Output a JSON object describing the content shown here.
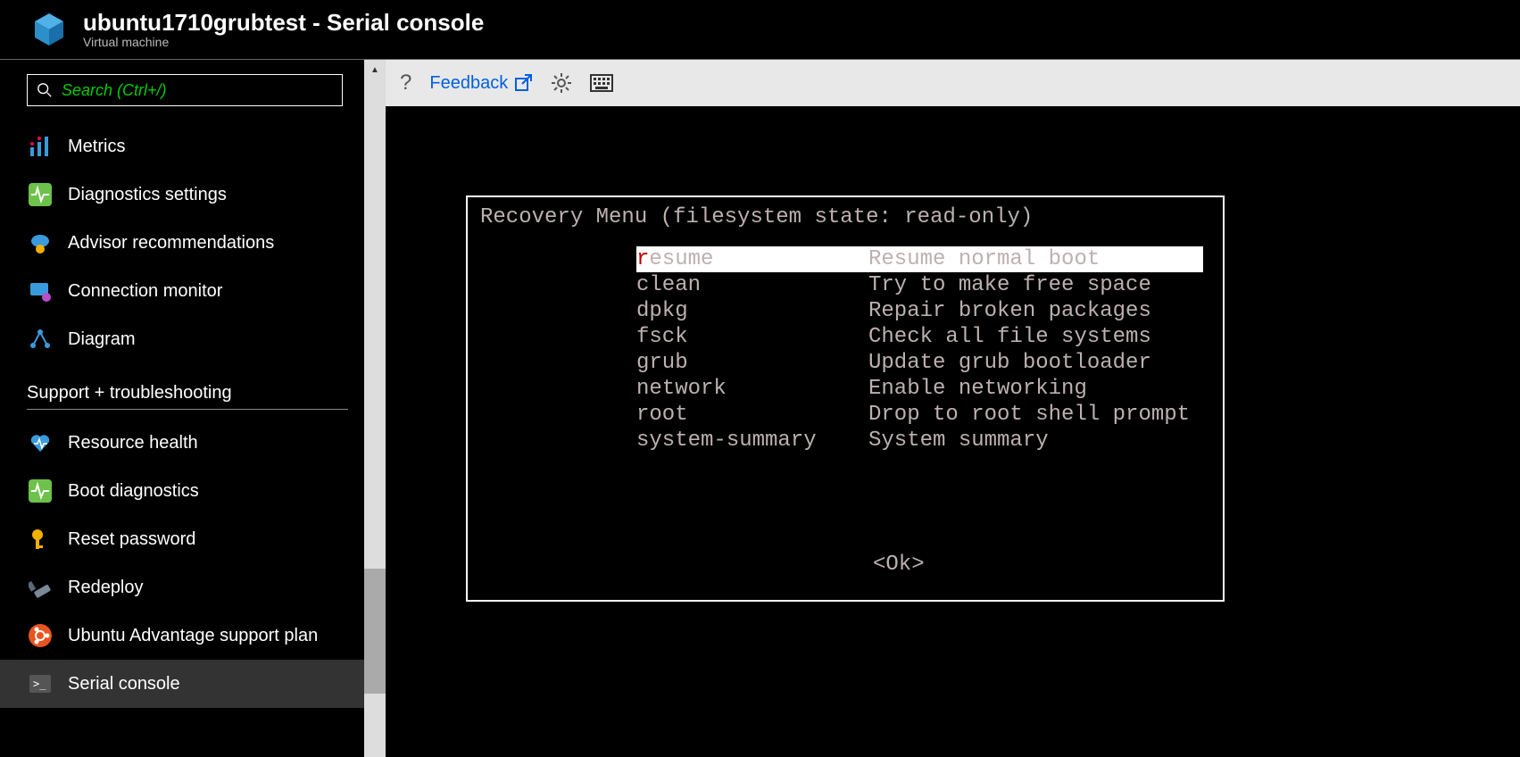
{
  "header": {
    "title": "ubuntu1710grubtest - Serial console",
    "subtitle": "Virtual machine"
  },
  "search": {
    "placeholder": "Search (Ctrl+/)"
  },
  "sidebar": {
    "items1": [
      {
        "label": "Metrics"
      },
      {
        "label": "Diagnostics settings"
      },
      {
        "label": "Advisor recommendations"
      },
      {
        "label": "Connection monitor"
      },
      {
        "label": "Diagram"
      }
    ],
    "section": "Support + troubleshooting",
    "items2": [
      {
        "label": "Resource health"
      },
      {
        "label": "Boot diagnostics"
      },
      {
        "label": "Reset password"
      },
      {
        "label": "Redeploy"
      },
      {
        "label": "Ubuntu Advantage support plan"
      },
      {
        "label": "Serial console"
      }
    ]
  },
  "toolbar": {
    "help": "?",
    "feedback": "Feedback"
  },
  "console": {
    "title": "Recovery Menu (filesystem state: read-only)",
    "items": [
      {
        "cmd": "resume",
        "desc": "Resume normal boot",
        "selected": true
      },
      {
        "cmd": "clean",
        "desc": "Try to make free space"
      },
      {
        "cmd": "dpkg",
        "desc": "Repair broken packages"
      },
      {
        "cmd": "fsck",
        "desc": "Check all file systems"
      },
      {
        "cmd": "grub",
        "desc": "Update grub bootloader"
      },
      {
        "cmd": "network",
        "desc": "Enable networking"
      },
      {
        "cmd": "root",
        "desc": "Drop to root shell prompt"
      },
      {
        "cmd": "system-summary",
        "desc": "System summary"
      }
    ],
    "ok": "<Ok>"
  }
}
